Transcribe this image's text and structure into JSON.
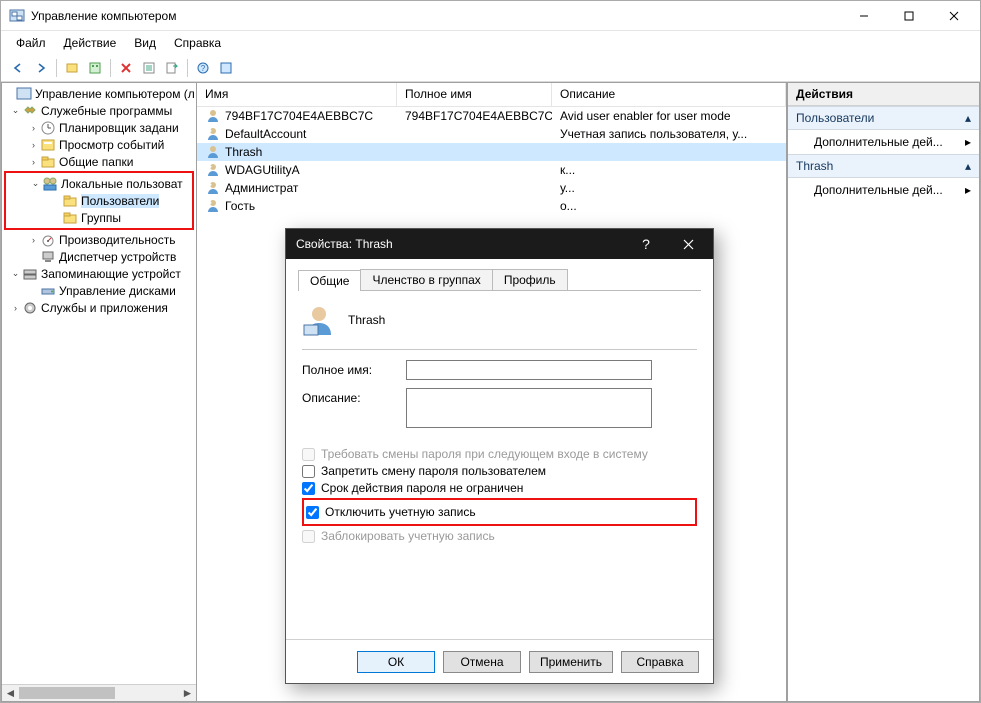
{
  "title": "Управление компьютером",
  "menu": [
    "Файл",
    "Действие",
    "Вид",
    "Справка"
  ],
  "tree": {
    "root": "Управление компьютером (л",
    "group1": "Служебные программы",
    "g1_sched": "Планировщик задани",
    "g1_event": "Просмотр событий",
    "g1_shared": "Общие папки",
    "g1_users": "Локальные пользоват",
    "g1_users_folder": "Пользователи",
    "g1_users_groups": "Группы",
    "g1_perf": "Производительность",
    "g1_dev": "Диспетчер устройств",
    "group2": "Запоминающие устройст",
    "g2_disk": "Управление дисками",
    "group3": "Службы и приложения"
  },
  "list": {
    "columns": [
      "Имя",
      "Полное имя",
      "Описание"
    ],
    "rows": [
      {
        "name": "794BF17C704E4AEBBC7C",
        "full": "794BF17C704E4AEBBC7C",
        "desc": "Avid user enabler for user mode"
      },
      {
        "name": "DefaultAccount",
        "full": "",
        "desc": "Учетная запись пользователя, у..."
      },
      {
        "name": "Thrash",
        "full": "",
        "desc": ""
      },
      {
        "name": "WDAGUtilityA",
        "full": "",
        "desc": "к..."
      },
      {
        "name": "Администрат",
        "full": "",
        "desc": "у..."
      },
      {
        "name": "Гость",
        "full": "",
        "desc": "о..."
      }
    ]
  },
  "actions": {
    "header": "Действия",
    "g1": "Пользователи",
    "item": "Дополнительные дей...",
    "g2": "Thrash"
  },
  "dlg": {
    "title": "Свойства: Thrash",
    "tabs": [
      "Общие",
      "Членство в группах",
      "Профиль"
    ],
    "user": "Thrash",
    "lab_full": "Полное имя:",
    "lab_desc": "Описание:",
    "chk_reqchange": "Требовать смены пароля при следующем входе в систему",
    "chk_nochange": "Запретить смену пароля пользователем",
    "chk_never": "Срок действия пароля не ограничен",
    "chk_disable": "Отключить учетную запись",
    "chk_lock": "Заблокировать учетную запись",
    "btn_ok": "ОК",
    "btn_cancel": "Отмена",
    "btn_apply": "Применить",
    "btn_help": "Справка"
  }
}
